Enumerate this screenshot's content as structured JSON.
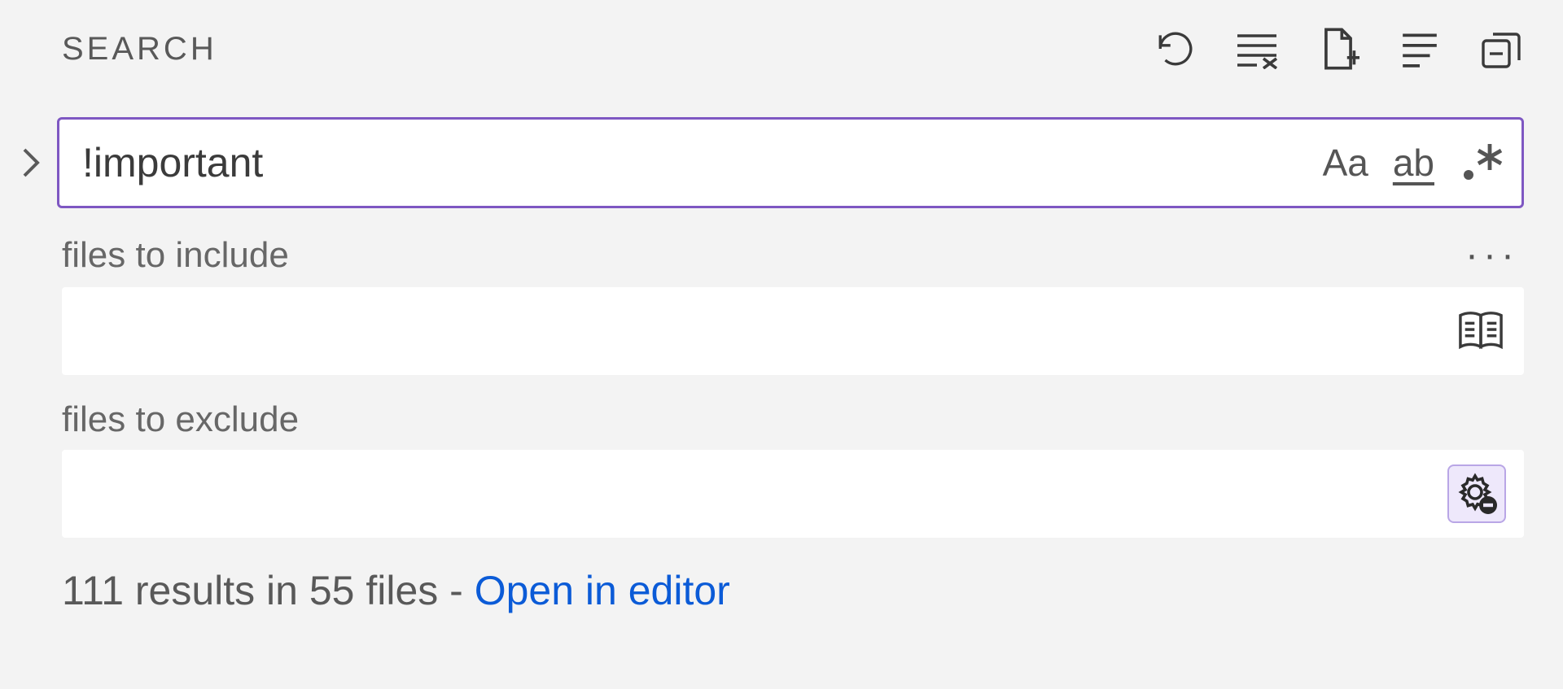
{
  "header": {
    "title": "SEARCH",
    "actions": {
      "refresh": "Refresh",
      "clear": "Clear Search Results",
      "newEditor": "Open New Search Editor",
      "viewAsTree": "View as Tree",
      "collapse": "Collapse All"
    }
  },
  "search": {
    "value": "!important",
    "toggles": {
      "matchCase": "Aa",
      "wholeWord": "ab",
      "regex": ".*"
    }
  },
  "include": {
    "label": "files to include",
    "value": "",
    "more": "···"
  },
  "exclude": {
    "label": "files to exclude",
    "value": ""
  },
  "results": {
    "text": "111 results in 55 files - ",
    "link": "Open in editor"
  }
}
